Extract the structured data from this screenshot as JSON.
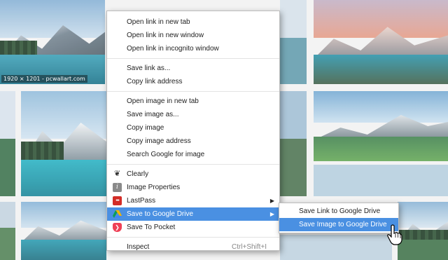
{
  "background": {
    "caption": "1920 × 1201 - pcwallart.com",
    "tile_colors": {
      "sky_blue": "#8fb7d8",
      "sunset": "#e8a48f",
      "mountain": "#7d8c98",
      "snow": "#e8edf2",
      "lake": "#3a9cb0",
      "forest": "#3d5f44"
    }
  },
  "context_menu": {
    "items": [
      {
        "label": "Open link in new tab"
      },
      {
        "label": "Open link in new window"
      },
      {
        "label": "Open link in incognito window"
      },
      {
        "label": "Save link as..."
      },
      {
        "label": "Copy link address"
      },
      {
        "label": "Open image in new tab"
      },
      {
        "label": "Save image as..."
      },
      {
        "label": "Copy image"
      },
      {
        "label": "Copy image address"
      },
      {
        "label": "Search Google for image"
      },
      {
        "label": "Clearly",
        "icon": "clearly-icon"
      },
      {
        "label": "Image Properties",
        "icon": "info-icon"
      },
      {
        "label": "LastPass",
        "icon": "lastpass-icon"
      },
      {
        "label": "Save to Google Drive",
        "icon": "google-drive-icon"
      },
      {
        "label": "Save To Pocket",
        "icon": "pocket-icon"
      },
      {
        "label": "Inspect",
        "shortcut": "Ctrl+Shift+I"
      }
    ]
  },
  "submenu": {
    "items": [
      {
        "label": "Save Link to Google Drive"
      },
      {
        "label": "Save Image to Google Drive"
      }
    ]
  },
  "colors": {
    "highlight": "#4a90e2",
    "lastpass": "#d32d27",
    "pocket": "#ef4056",
    "drive": "#f4b400"
  }
}
